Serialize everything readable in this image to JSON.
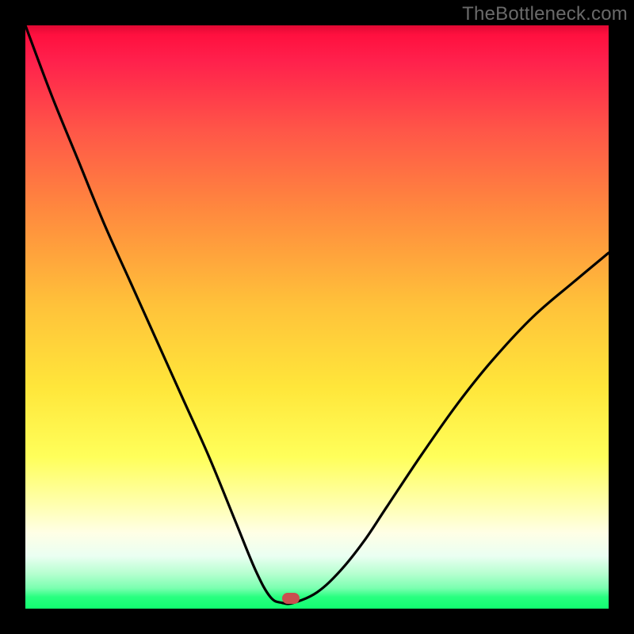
{
  "watermark": "TheBottleneck.com",
  "marker": {
    "cx_frac": 0.455,
    "cy_frac": 0.983
  },
  "chart_data": {
    "type": "line",
    "title": "",
    "xlabel": "",
    "ylabel": "",
    "xlim": [
      0,
      1
    ],
    "ylim": [
      0,
      1
    ],
    "grid": false,
    "legend": false,
    "series": [
      {
        "name": "curve",
        "x": [
          0.0,
          0.045,
          0.09,
          0.135,
          0.18,
          0.225,
          0.27,
          0.315,
          0.36,
          0.395,
          0.42,
          0.44,
          0.46,
          0.5,
          0.54,
          0.58,
          0.62,
          0.68,
          0.74,
          0.8,
          0.87,
          0.94,
          1.0
        ],
        "y": [
          1.0,
          0.88,
          0.77,
          0.66,
          0.56,
          0.46,
          0.36,
          0.26,
          0.15,
          0.065,
          0.02,
          0.01,
          0.01,
          0.028,
          0.065,
          0.115,
          0.175,
          0.265,
          0.35,
          0.425,
          0.5,
          0.56,
          0.61
        ],
        "color": "#000000"
      }
    ],
    "annotations": [
      {
        "type": "marker",
        "x": 0.455,
        "y": 0.017,
        "color": "#c94f4f",
        "shape": "pill"
      }
    ],
    "background_gradient": {
      "direction": "vertical",
      "stops": [
        {
          "pos": 0.0,
          "color": "#ff0a3a"
        },
        {
          "pos": 0.32,
          "color": "#ff8a3e"
        },
        {
          "pos": 0.62,
          "color": "#ffe63a"
        },
        {
          "pos": 0.87,
          "color": "#ffffe6"
        },
        {
          "pos": 1.0,
          "color": "#12ff70"
        }
      ]
    }
  }
}
